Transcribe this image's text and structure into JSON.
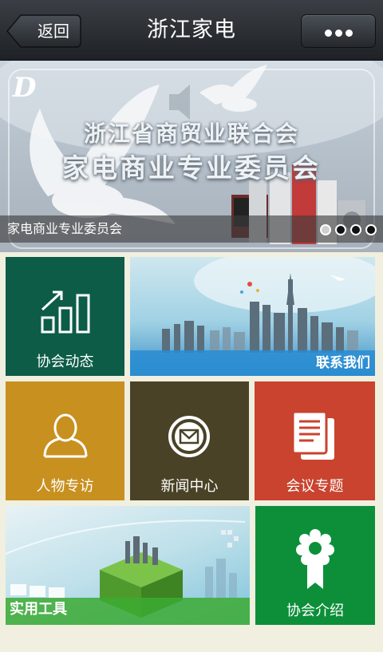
{
  "header": {
    "back_label": "返回",
    "title": "浙江家电",
    "more_icon": "more-dots-icon"
  },
  "banner": {
    "logo_text": "D",
    "heading_line1": "浙江省商贸业联合会",
    "heading_line2": "家电商业专业委员会",
    "caption": "家电商业专业委员会",
    "slide_count": 4,
    "active_slide": 1
  },
  "tiles": {
    "news": {
      "label": "协会动态",
      "icon": "bar-chart-icon",
      "color": "#0c5c48"
    },
    "contact": {
      "label": "联系我们",
      "image": "city-skyline-image"
    },
    "people": {
      "label": "人物专访",
      "icon": "person-icon",
      "color": "#c8901f"
    },
    "press": {
      "label": "新闻中心",
      "icon": "mail-icon",
      "color": "#4a4226"
    },
    "meeting": {
      "label": "会议专题",
      "icon": "documents-icon",
      "color": "#c9432e"
    },
    "tools": {
      "label": "实用工具",
      "image": "green-cube-city-image"
    },
    "about": {
      "label": "协会介绍",
      "icon": "award-ribbon-icon",
      "color": "#0d8f3a"
    }
  }
}
